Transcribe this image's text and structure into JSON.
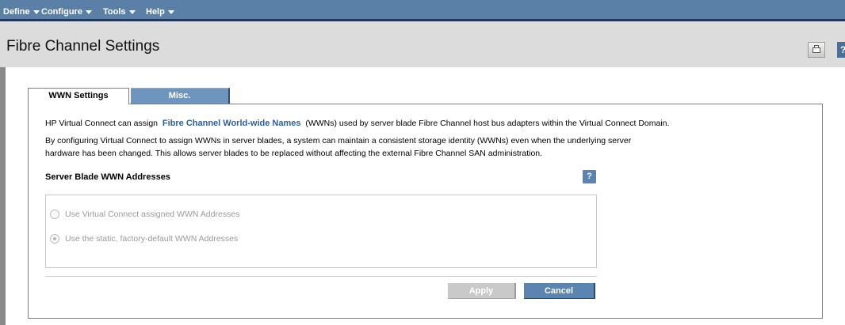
{
  "menu": {
    "items": [
      {
        "label": "Define"
      },
      {
        "label": "Configure"
      },
      {
        "label": "Tools"
      },
      {
        "label": "Help"
      }
    ]
  },
  "page": {
    "title": "Fibre Channel Settings",
    "help_icon_label": "?"
  },
  "tabs": [
    {
      "label": "WWN Settings",
      "active": true
    },
    {
      "label": "Misc.",
      "active": false
    }
  ],
  "content": {
    "intro_before": "HP Virtual Connect can assign",
    "intro_link": "Fibre Channel World-wide Names",
    "intro_after": "(WWNs) used by server blade Fibre Channel host bus adapters within the Virtual Connect Domain.",
    "para2_line1": "By configuring Virtual Connect to assign WWNs in server blades, a system can maintain a consistent storage identity (WWNs) even when the underlying server",
    "para2_line2": "hardware has been changed. This allows server blades to be replaced without affecting the external Fibre Channel SAN administration.",
    "section_title": "Server Blade WWN Addresses",
    "section_help": "?",
    "options": [
      {
        "label": "Use Virtual Connect assigned WWN Addresses",
        "checked": false
      },
      {
        "label": "Use the static, factory-default WWN Addresses",
        "checked": true
      }
    ]
  },
  "buttons": {
    "apply": "Apply",
    "cancel": "Cancel"
  },
  "colors": {
    "menubar": "#5b80a8",
    "accent": "#5c84b0",
    "link": "#2c5e9e"
  }
}
